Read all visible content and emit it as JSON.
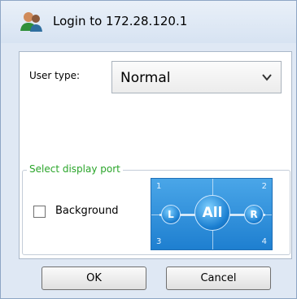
{
  "window": {
    "title": "Login to 172.28.120.1",
    "icon": "user-group-icon"
  },
  "user_type": {
    "label": "User type:",
    "selected": "Normal"
  },
  "display_port": {
    "group_label": "Select display port",
    "background_checkbox_label": "Background",
    "background_checked": false,
    "quadrants": [
      "1",
      "2",
      "3",
      "4"
    ],
    "buttons": {
      "left": "L",
      "all": "All",
      "right": "R"
    }
  },
  "buttons": {
    "ok": "OK",
    "cancel": "Cancel"
  },
  "colors": {
    "group_label": "#2aa52a",
    "port_panel": "#1e7fd0"
  }
}
